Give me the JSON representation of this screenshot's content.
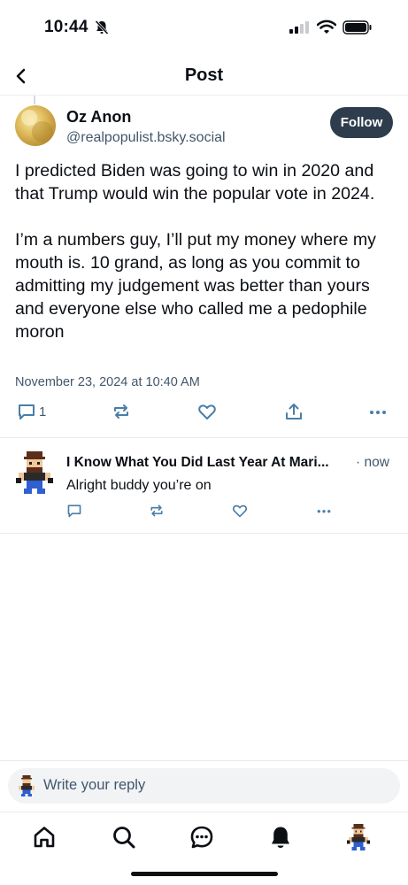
{
  "status_bar": {
    "time": "10:44",
    "icons": [
      "bell-off-icon",
      "signal-icon",
      "wifi-icon",
      "battery-icon"
    ]
  },
  "header": {
    "title": "Post",
    "back_icon": "chevron-left-icon"
  },
  "post": {
    "author": "Oz Anon",
    "handle": "@realpopulist.bsky.social",
    "follow_label": "Follow",
    "text": "I predicted Biden was going to win in 2020 and that Trump would win the popular vote in 2024.\n\nI’m a numbers guy, I’ll put my money where my mouth is. 10 grand, as long as you commit to admitting my judgement was better than yours and everyone else who called me a pedophile moron",
    "timestamp": "November 23, 2024 at 10:40 AM",
    "reply_count": "1",
    "actions": [
      "reply-icon",
      "repost-icon",
      "like-icon",
      "share-icon",
      "more-icon"
    ]
  },
  "reply": {
    "author": "I Know What You Did Last Year At Mari...",
    "time": "· now",
    "text": "Alright buddy you’re on",
    "actions": [
      "reply-icon",
      "repost-icon",
      "like-icon",
      "more-icon"
    ]
  },
  "composer": {
    "placeholder": "Write your reply"
  },
  "tab_bar": {
    "tabs": [
      "home-icon",
      "search-icon",
      "chat-icon",
      "notifications-icon",
      "profile-avatar"
    ]
  },
  "colors": {
    "text": "#0b0f14",
    "secondary": "#42576c",
    "follow_button": "#2e3d4d",
    "icon": "#4a7ea8"
  }
}
